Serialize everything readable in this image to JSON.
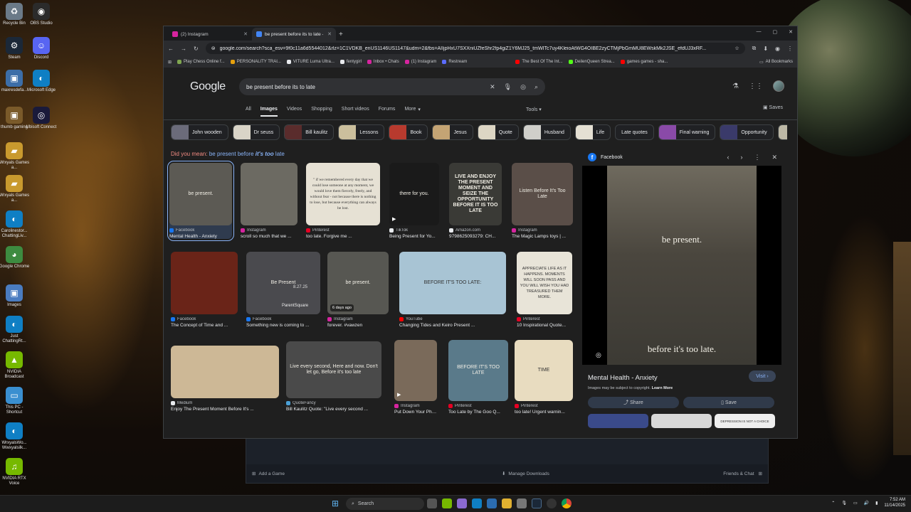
{
  "desktop": {
    "icons": [
      {
        "label": "Recycle Bin",
        "icon": "recycle-bin-icon",
        "color": "#6b7a88"
      },
      {
        "label": "OBS Studio",
        "icon": "obs-icon",
        "color": "#2b2b2b"
      },
      {
        "label": "Steam",
        "icon": "steam-icon",
        "color": "#1b2838"
      },
      {
        "label": "Discord",
        "icon": "discord-icon",
        "color": "#5865f2"
      },
      {
        "label": "maxresdefa...",
        "icon": "image-file-icon",
        "color": "#3c6ea8"
      },
      {
        "label": "Microsoft Edge",
        "icon": "edge-icon",
        "color": "#0f7fc4"
      },
      {
        "label": "thumb gaming",
        "icon": "image-file-icon",
        "color": "#7a5a2a"
      },
      {
        "label": "Ubisoft Connect",
        "icon": "ubisoft-icon",
        "color": "#1a1a3a"
      },
      {
        "label": "Wrxyals Games a...",
        "icon": "folder-icon",
        "color": "#c99a2e"
      },
      {
        "label": "Wrxyals Games a...",
        "icon": "folder-icon",
        "color": "#c99a2e"
      },
      {
        "label": "Carolinestor... ChattingLiv...",
        "icon": "edge-icon",
        "color": "#0f7fc4"
      },
      {
        "label": "Google Chrome",
        "icon": "chrome-icon",
        "color": "#3d8b40"
      },
      {
        "label": "Images",
        "icon": "image-file-icon",
        "color": "#4a7cc0"
      },
      {
        "label": "Just ChattingRt...",
        "icon": "edge-icon",
        "color": "#0f7fc4"
      },
      {
        "label": "NVIDIA Broadcast",
        "icon": "nvidia-icon",
        "color": "#76b900"
      },
      {
        "label": "This PC - Shortcut",
        "icon": "monitor-icon",
        "color": "#3a8fd0"
      },
      {
        "label": "WrxyalsWo... Wwxyalsilk...",
        "icon": "edge-icon",
        "color": "#0f7fc4"
      },
      {
        "label": "NVIDIA RTX Voice",
        "icon": "headset-icon",
        "color": "#76b900"
      }
    ]
  },
  "background_app": {
    "add_game": "Add a Game",
    "manage_downloads": "Manage Downloads",
    "friends_chat": "Friends & Chat"
  },
  "browser": {
    "tabs": [
      {
        "label": "(2) Instagram",
        "color": "#d6249f"
      },
      {
        "label": "be present before its to late - G",
        "color": "#4285f4"
      }
    ],
    "new_tab": "+",
    "window_controls": [
      "—",
      "▢",
      "✕"
    ],
    "url": "google.com/search?sca_esv=9f0c11a6d5544012&rlz=1C1VDKB_enUS1146US1147&udm=2&fbs=AIIjpHxU7SXXniUZfeShr2fp4giZ1Y6MJ25_tmWITc7uy4KleioAtWG4OIBE2zyCTMjPbGmMU8EWskMk2JSE_efdUJ3xRF...",
    "bookmarks": [
      {
        "label": "Play Chess Online f...",
        "color": "#7fa650"
      },
      {
        "label": "PERSONALITY TRAI...",
        "color": "#e5a00d"
      },
      {
        "label": "VITURE Luma Ultra...",
        "color": "#e8eaed"
      },
      {
        "label": "fentygirl",
        "color": "#e8eaed"
      },
      {
        "label": "Inbox • Chats",
        "color": "#d6249f"
      },
      {
        "label": "(1) Instagram",
        "color": "#d6249f"
      },
      {
        "label": "Restream",
        "color": "#5b6cff"
      },
      {
        "label": "The Best Of The Int...",
        "color": "#ff0000"
      },
      {
        "label": "DeilenQueen Strea...",
        "color": "#53fc18"
      },
      {
        "label": "games games - sha...",
        "color": "#ff0000"
      }
    ],
    "all_bookmarks": "All Bookmarks"
  },
  "google": {
    "logo": "Google",
    "query": "be present before its to late",
    "nav": [
      "All",
      "Images",
      "Videos",
      "Shopping",
      "Short videos",
      "Forums",
      "More"
    ],
    "active_nav": "Images",
    "tools": "Tools",
    "saves": "Saves",
    "chips": [
      {
        "label": "John wooden",
        "color": "#6b6b7a"
      },
      {
        "label": "Dr seuss",
        "color": "#d9d4c7"
      },
      {
        "label": "Bill kaulitz",
        "color": "#5a2c2c"
      },
      {
        "label": "Lessons",
        "color": "#cbbf9d"
      },
      {
        "label": "Book",
        "color": "#b83a2e"
      },
      {
        "label": "Jesus",
        "color": "#c4a474"
      },
      {
        "label": "Quote",
        "color": "#ddd6c4"
      },
      {
        "label": "Husband",
        "color": "#d0cfca"
      },
      {
        "label": "Life",
        "color": "#e5e0d3"
      },
      {
        "label": "Late quotes",
        "color": ""
      },
      {
        "label": "Final warning",
        "color": "#8a4aa8"
      },
      {
        "label": "Opportunity",
        "color": "#3a3a6a"
      },
      {
        "label": "D",
        "color": "#bdb8a6"
      }
    ],
    "did_you_mean_prefix": "Did you mean:",
    "did_you_mean_a": "be present before",
    "did_you_mean_em": "it's too",
    "did_you_mean_b": "late",
    "results": [
      {
        "source": "Facebook",
        "title": "Mental Health - Anxiety",
        "src_color": "#1877f2",
        "bg": "#5c5a54",
        "overlay": "be present."
      },
      {
        "source": "Instagram",
        "title": "scroll so much that we ...",
        "src_color": "#d6249f",
        "bg": "#6c6a62",
        "overlay": ""
      },
      {
        "source": "Pinterest",
        "title": "too late. Forgive me ...",
        "src_color": "#e60023",
        "bg": "#e6e1d4",
        "overlay": "\" if we remembered every day that we could lose someone at any moment, we would love them fiercely, freely, and without fear - not because there is nothing to lose, but because everything can always be lost."
      },
      {
        "source": "TikTok",
        "title": "Being Present for Yo...",
        "src_color": "#e8eaed",
        "bg": "#1a1a1a",
        "overlay": "there for you."
      },
      {
        "source": "Amazon.com",
        "title": "9798625093279: CH...",
        "src_color": "#e8eaed",
        "bg": "#3a3a36",
        "overlay": "LIVE AND ENJOY THE PRESENT MOMENT AND SEIZE THE OPPORTUNITY BEFORE IT IS TOO LATE"
      },
      {
        "source": "Instagram",
        "title": "The Magic Lamps toys | ...",
        "src_color": "#d6249f",
        "bg": "#5a4e48",
        "overlay": "Listen Before It's Too Late"
      },
      {
        "source": "Facebook",
        "title": "The Concept of Time and ...",
        "src_color": "#1877f2",
        "bg": "#6a2418",
        "overlay": ""
      },
      {
        "source": "Facebook",
        "title": "Something new is coming to ...",
        "src_color": "#1877f2",
        "bg": "#4a4a4e",
        "overlay": "Be Present"
      },
      {
        "source": "Instagram",
        "title": "forever. #vawzen",
        "src_color": "#d6249f",
        "bg": "#575752",
        "overlay": "be present."
      },
      {
        "source": "YouTube",
        "title": "Changing Tides and Keiro Present ...",
        "src_color": "#ff0000",
        "bg": "#a8c4d4",
        "overlay": "BEFORE IT'S TOO LATE:"
      },
      {
        "source": "Pinterest",
        "title": "10 Inspirational Quote...",
        "src_color": "#e60023",
        "bg": "#e8e4d8",
        "overlay": "APPRECIATE LIFE AS IT HAPPENS. MOMENTS WILL SOON PASS AND YOU WILL WISH YOU HAD TREASURED THEM MORE."
      },
      {
        "source": "Medium",
        "title": "Enjoy The Present Moment Before It's ...",
        "src_color": "#e8eaed",
        "bg": "#cdb896",
        "overlay": ""
      },
      {
        "source": "QuoteFancy",
        "title": "Bill Kaulitz Quote: \"Live every second ...",
        "src_color": "#4a9fd5",
        "bg": "#4a4a4a",
        "overlay": "Live every second, Here and now. Don't let go, Before it's too late"
      },
      {
        "source": "Instagram",
        "title": "Put Down Your Pho...",
        "src_color": "#d6249f",
        "bg": "#7a6a5a",
        "overlay": ""
      },
      {
        "source": "Pinterest",
        "title": "Too Late by The Goo Q...",
        "src_color": "#e60023",
        "bg": "#5a7a8a",
        "overlay": "BEFORE IT'S TOO LATE"
      },
      {
        "source": "Pinterest",
        "title": "too late! Urgent warnin...",
        "src_color": "#e60023",
        "bg": "#e8dcc0",
        "overlay": "TIME"
      }
    ],
    "result_badges": {
      "video": "▶",
      "days_ago": "6 days ago",
      "parentsquare": "ParentSquare",
      "date": "8.27.25"
    },
    "preview": {
      "source": "Facebook",
      "top_text": "be present.",
      "bottom_text": "before it's too late.",
      "title": "Mental Health - Anxiety",
      "visit": "Visit",
      "copyright": "Images may be subject to copyright.",
      "learn_more": "Learn More",
      "share": "Share",
      "save": "Save",
      "related_text": "DEPRESSION IS NOT A CHOICE"
    }
  },
  "taskbar": {
    "search_placeholder": "Search",
    "time": "7:52 AM",
    "date": "11/14/2025"
  }
}
